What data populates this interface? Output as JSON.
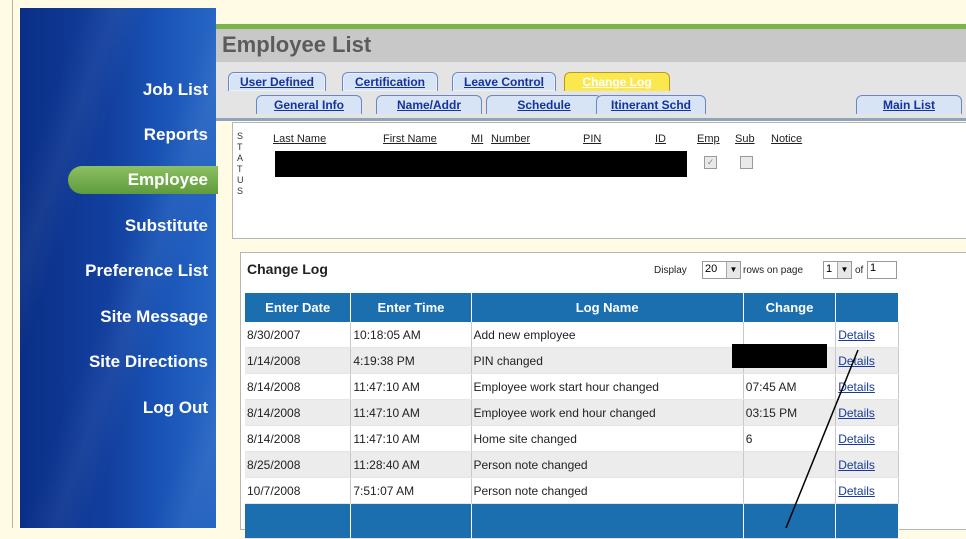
{
  "page": {
    "title": "Employee List"
  },
  "sidebar": {
    "items": [
      {
        "label": "Job List"
      },
      {
        "label": "Reports"
      },
      {
        "label": "Employee"
      },
      {
        "label": "Substitute"
      },
      {
        "label": "Preference List"
      },
      {
        "label": "Site Message"
      },
      {
        "label": "Site Directions"
      },
      {
        "label": "Log Out"
      }
    ]
  },
  "tabs": {
    "row1": [
      "User Defined",
      "Certification",
      "Leave Control",
      "Change Log"
    ],
    "row2": [
      "General Info",
      "Name/Addr",
      "Schedule",
      "Itinerant Schd"
    ],
    "main_list": "Main List",
    "active": "Change Log"
  },
  "employee": {
    "status_label": [
      "S",
      "T",
      "A",
      "T",
      "U",
      "S"
    ],
    "headers": [
      "Last Name",
      "First Name",
      "MI",
      "Number",
      "PIN",
      "ID",
      "Emp",
      "Sub",
      "Notice"
    ],
    "emp_checked": true,
    "sub_checked": false
  },
  "change_log": {
    "title": "Change Log",
    "display_label": "Display",
    "rows_per_page": "20",
    "rows_on_page_label": "rows on page",
    "page": "1",
    "of_label": "of",
    "total_pages": "1",
    "columns": [
      "Enter Date",
      "Enter Time",
      "Log Name",
      "Change",
      ""
    ],
    "rows": [
      {
        "date": "8/30/2007",
        "time": "10:18:05 AM",
        "name": "Add new employee",
        "change": "",
        "link": "Details"
      },
      {
        "date": "1/14/2008",
        "time": "4:19:38 PM",
        "name": "PIN changed",
        "change": "",
        "link": "Details"
      },
      {
        "date": "8/14/2008",
        "time": "11:47:10 AM",
        "name": "Employee work start hour changed",
        "change": "07:45 AM",
        "link": "Details"
      },
      {
        "date": "8/14/2008",
        "time": "11:47:10 AM",
        "name": "Employee work end hour changed",
        "change": "03:15 PM",
        "link": "Details"
      },
      {
        "date": "8/14/2008",
        "time": "11:47:10 AM",
        "name": "Home site changed",
        "change": "6",
        "link": "Details"
      },
      {
        "date": "8/25/2008",
        "time": "11:28:40 AM",
        "name": "Person note changed",
        "change": "",
        "link": "Details"
      },
      {
        "date": "10/7/2008",
        "time": "7:51:07 AM",
        "name": "Person note changed",
        "change": "",
        "link": "Details"
      }
    ]
  }
}
